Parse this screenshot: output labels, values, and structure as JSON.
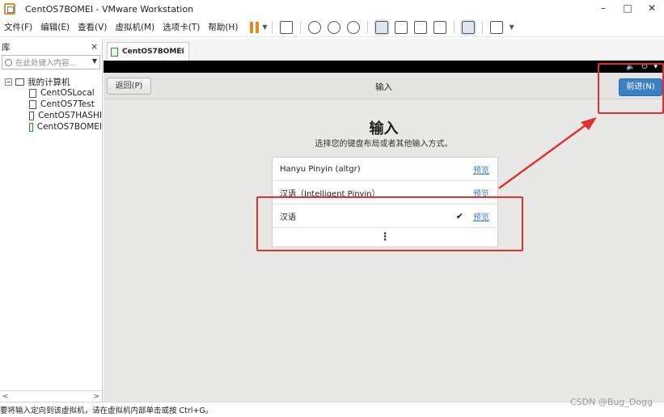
{
  "window": {
    "title": "CentOS7BOMEI - VMware Workstation",
    "controls": [
      "–",
      "□",
      "✕"
    ]
  },
  "menu": {
    "items": [
      "文件(F)",
      "编辑(E)",
      "查看(V)",
      "虚拟机(M)",
      "选项卡(T)",
      "帮助(H)"
    ]
  },
  "library": {
    "title": "库",
    "close": "×",
    "search_placeholder": "在此处键入内容...",
    "root_label": "我的计算机",
    "expander": "⊟",
    "vms": [
      "CentOSLocal",
      "CentOS7Test",
      "CentOS7HASHI",
      "CentOS7BOMEI"
    ],
    "scroll_left": "<",
    "scroll_right": ">"
  },
  "tab": {
    "label": "CentOS7BOMEI",
    "close": "✕"
  },
  "vm": {
    "topbar_icons": [
      "volume-icon",
      "power-icon",
      "dropdown-icon"
    ],
    "back_label": "返回(P)",
    "header_title": "输入",
    "next_label": "前进(N)",
    "page_title": "输入",
    "page_subtitle": "选择您的键盘布局或者其他输入方式。",
    "layouts": [
      {
        "label": "Hanyu Pinyin (altgr)",
        "preview": "预览",
        "selected": false
      },
      {
        "label": "汉语（Intelligent Pinyin）",
        "preview": "预览",
        "selected": false
      },
      {
        "label": "汉语",
        "preview": "预览",
        "selected": true
      }
    ],
    "check_mark": "✔",
    "more": "⋮"
  },
  "status": {
    "text": "要将输入定向到该虚拟机，请在虚拟机内部单击或按 Ctrl+G。"
  },
  "watermark": "CSDN @Bug_Dogg",
  "colors": {
    "accent_blue": "#3b7fc4",
    "annotation_red": "#e23030",
    "pause_orange": "#e88a1a"
  }
}
